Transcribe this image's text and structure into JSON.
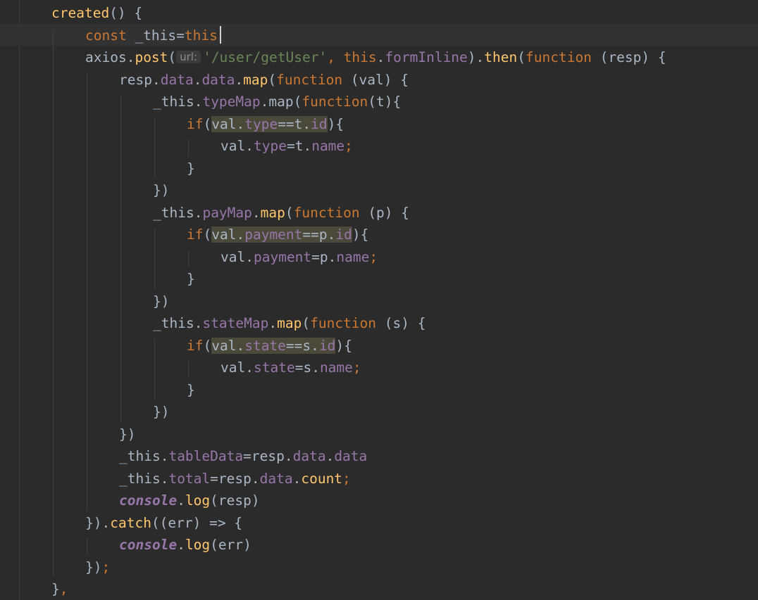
{
  "editor": {
    "theme": {
      "background": "#2b2b2b",
      "keyword": "#cc7832",
      "function": "#ffc66d",
      "property": "#9876aa",
      "string": "#6a8759",
      "text": "#a9b7c6"
    },
    "lines": [
      {
        "indent": 1,
        "tokens": [
          {
            "t": "created",
            "c": "fn"
          },
          {
            "t": "() {",
            "c": "punc"
          }
        ]
      },
      {
        "indent": 2,
        "current": true,
        "tokens": [
          {
            "t": "const ",
            "c": "kw"
          },
          {
            "t": "_this=",
            "c": "var"
          },
          {
            "t": "this",
            "c": "kw"
          }
        ]
      },
      {
        "indent": 2,
        "tokens": [
          {
            "t": "axios",
            "c": "var"
          },
          {
            "t": ".",
            "c": "punc"
          },
          {
            "t": "post",
            "c": "fn"
          },
          {
            "t": "(",
            "c": "punc"
          },
          {
            "t": "url:",
            "c": "hint"
          },
          {
            "t": "'/user/getUser'",
            "c": "str"
          },
          {
            "t": ", ",
            "c": "semi"
          },
          {
            "t": "this",
            "c": "kw"
          },
          {
            "t": ".",
            "c": "punc"
          },
          {
            "t": "formInline",
            "c": "prop"
          },
          {
            "t": ").",
            "c": "punc"
          },
          {
            "t": "then",
            "c": "fn"
          },
          {
            "t": "(",
            "c": "punc"
          },
          {
            "t": "function ",
            "c": "kw"
          },
          {
            "t": "(resp) {",
            "c": "punc"
          }
        ]
      },
      {
        "indent": 3,
        "tokens": [
          {
            "t": "resp",
            "c": "var"
          },
          {
            "t": ".",
            "c": "punc"
          },
          {
            "t": "data",
            "c": "prop"
          },
          {
            "t": ".",
            "c": "punc"
          },
          {
            "t": "data",
            "c": "prop"
          },
          {
            "t": ".",
            "c": "punc"
          },
          {
            "t": "map",
            "c": "fn"
          },
          {
            "t": "(",
            "c": "punc"
          },
          {
            "t": "function ",
            "c": "kw"
          },
          {
            "t": "(val) {",
            "c": "punc"
          }
        ]
      },
      {
        "indent": 4,
        "tokens": [
          {
            "t": "_this",
            "c": "var"
          },
          {
            "t": ".",
            "c": "punc"
          },
          {
            "t": "typeMap",
            "c": "prop"
          },
          {
            "t": ".",
            "c": "punc"
          },
          {
            "t": "map",
            "c": "var"
          },
          {
            "t": "(",
            "c": "punc"
          },
          {
            "t": "function",
            "c": "kw"
          },
          {
            "t": "(t){",
            "c": "punc"
          }
        ]
      },
      {
        "indent": 5,
        "tokens": [
          {
            "t": "if",
            "c": "kw"
          },
          {
            "t": "(",
            "c": "punc"
          },
          {
            "t": "val",
            "c": "var",
            "hl": true
          },
          {
            "t": ".",
            "c": "punc",
            "hl": true
          },
          {
            "t": "type",
            "c": "prop",
            "hl": true
          },
          {
            "t": "==",
            "c": "var",
            "hl": true
          },
          {
            "t": "t",
            "c": "var",
            "hl": true
          },
          {
            "t": ".",
            "c": "punc",
            "hl": true
          },
          {
            "t": "id",
            "c": "prop",
            "hl": true
          },
          {
            "t": "){",
            "c": "punc"
          }
        ]
      },
      {
        "indent": 6,
        "tokens": [
          {
            "t": "val",
            "c": "var"
          },
          {
            "t": ".",
            "c": "punc"
          },
          {
            "t": "type",
            "c": "prop"
          },
          {
            "t": "=",
            "c": "var"
          },
          {
            "t": "t",
            "c": "var"
          },
          {
            "t": ".",
            "c": "punc"
          },
          {
            "t": "name",
            "c": "prop"
          },
          {
            "t": ";",
            "c": "semi"
          }
        ]
      },
      {
        "indent": 5,
        "tokens": [
          {
            "t": "}",
            "c": "punc"
          }
        ]
      },
      {
        "indent": 4,
        "tokens": [
          {
            "t": "})",
            "c": "punc"
          }
        ]
      },
      {
        "indent": 4,
        "tokens": [
          {
            "t": "_this",
            "c": "var"
          },
          {
            "t": ".",
            "c": "punc"
          },
          {
            "t": "payMap",
            "c": "prop"
          },
          {
            "t": ".",
            "c": "punc"
          },
          {
            "t": "map",
            "c": "fn"
          },
          {
            "t": "(",
            "c": "punc"
          },
          {
            "t": "function ",
            "c": "kw"
          },
          {
            "t": "(p) {",
            "c": "punc"
          }
        ]
      },
      {
        "indent": 5,
        "tokens": [
          {
            "t": "if",
            "c": "kw"
          },
          {
            "t": "(",
            "c": "punc"
          },
          {
            "t": "val",
            "c": "var",
            "hl": true
          },
          {
            "t": ".",
            "c": "punc",
            "hl": true
          },
          {
            "t": "payment",
            "c": "prop",
            "hl": true
          },
          {
            "t": "==",
            "c": "var",
            "hl": true
          },
          {
            "t": "p",
            "c": "var",
            "hl": true
          },
          {
            "t": ".",
            "c": "punc",
            "hl": true
          },
          {
            "t": "id",
            "c": "prop",
            "hl": true
          },
          {
            "t": "){",
            "c": "punc"
          }
        ]
      },
      {
        "indent": 6,
        "tokens": [
          {
            "t": "val",
            "c": "var"
          },
          {
            "t": ".",
            "c": "punc"
          },
          {
            "t": "payment",
            "c": "prop"
          },
          {
            "t": "=",
            "c": "var"
          },
          {
            "t": "p",
            "c": "var"
          },
          {
            "t": ".",
            "c": "punc"
          },
          {
            "t": "name",
            "c": "prop"
          },
          {
            "t": ";",
            "c": "semi"
          }
        ]
      },
      {
        "indent": 5,
        "tokens": [
          {
            "t": "}",
            "c": "punc"
          }
        ]
      },
      {
        "indent": 4,
        "tokens": [
          {
            "t": "})",
            "c": "punc"
          }
        ]
      },
      {
        "indent": 4,
        "tokens": [
          {
            "t": "_this",
            "c": "var"
          },
          {
            "t": ".",
            "c": "punc"
          },
          {
            "t": "stateMap",
            "c": "prop"
          },
          {
            "t": ".",
            "c": "punc"
          },
          {
            "t": "map",
            "c": "fn"
          },
          {
            "t": "(",
            "c": "punc"
          },
          {
            "t": "function ",
            "c": "kw"
          },
          {
            "t": "(s) {",
            "c": "punc"
          }
        ]
      },
      {
        "indent": 5,
        "tokens": [
          {
            "t": "if",
            "c": "kw"
          },
          {
            "t": "(",
            "c": "punc"
          },
          {
            "t": "val",
            "c": "var",
            "hl": true
          },
          {
            "t": ".",
            "c": "punc",
            "hl": true
          },
          {
            "t": "state",
            "c": "prop",
            "hl": true
          },
          {
            "t": "==",
            "c": "var",
            "hl": true
          },
          {
            "t": "s",
            "c": "var",
            "hl": true
          },
          {
            "t": ".",
            "c": "punc",
            "hl": true
          },
          {
            "t": "id",
            "c": "prop",
            "hl": true
          },
          {
            "t": "){",
            "c": "punc"
          }
        ]
      },
      {
        "indent": 6,
        "tokens": [
          {
            "t": "val",
            "c": "var"
          },
          {
            "t": ".",
            "c": "punc"
          },
          {
            "t": "state",
            "c": "prop"
          },
          {
            "t": "=",
            "c": "var"
          },
          {
            "t": "s",
            "c": "var"
          },
          {
            "t": ".",
            "c": "punc"
          },
          {
            "t": "name",
            "c": "prop"
          },
          {
            "t": ";",
            "c": "semi"
          }
        ]
      },
      {
        "indent": 5,
        "tokens": [
          {
            "t": "}",
            "c": "punc"
          }
        ]
      },
      {
        "indent": 4,
        "tokens": [
          {
            "t": "})",
            "c": "punc"
          }
        ]
      },
      {
        "indent": 3,
        "tokens": [
          {
            "t": "})",
            "c": "punc"
          }
        ]
      },
      {
        "indent": 3,
        "tokens": [
          {
            "t": "_this",
            "c": "var"
          },
          {
            "t": ".",
            "c": "punc"
          },
          {
            "t": "tableData",
            "c": "prop"
          },
          {
            "t": "=",
            "c": "var"
          },
          {
            "t": "resp",
            "c": "var"
          },
          {
            "t": ".",
            "c": "punc"
          },
          {
            "t": "data",
            "c": "prop"
          },
          {
            "t": ".",
            "c": "punc"
          },
          {
            "t": "data",
            "c": "prop"
          }
        ]
      },
      {
        "indent": 3,
        "tokens": [
          {
            "t": "_this",
            "c": "var"
          },
          {
            "t": ".",
            "c": "punc"
          },
          {
            "t": "total",
            "c": "prop"
          },
          {
            "t": "=",
            "c": "var"
          },
          {
            "t": "resp",
            "c": "var"
          },
          {
            "t": ".",
            "c": "punc"
          },
          {
            "t": "data",
            "c": "prop"
          },
          {
            "t": ".",
            "c": "punc"
          },
          {
            "t": "count",
            "c": "fn"
          },
          {
            "t": ";",
            "c": "semi"
          }
        ]
      },
      {
        "indent": 3,
        "tokens": [
          {
            "t": "console",
            "c": "console"
          },
          {
            "t": ".",
            "c": "punc"
          },
          {
            "t": "log",
            "c": "fn"
          },
          {
            "t": "(resp)",
            "c": "punc"
          }
        ]
      },
      {
        "indent": 2,
        "tokens": [
          {
            "t": "}).",
            "c": "punc"
          },
          {
            "t": "catch",
            "c": "fn"
          },
          {
            "t": "((err) => {",
            "c": "punc"
          }
        ]
      },
      {
        "indent": 3,
        "tokens": [
          {
            "t": "console",
            "c": "console"
          },
          {
            "t": ".",
            "c": "punc"
          },
          {
            "t": "log",
            "c": "fn"
          },
          {
            "t": "(err)",
            "c": "punc"
          }
        ]
      },
      {
        "indent": 2,
        "tokens": [
          {
            "t": "})",
            "c": "punc"
          },
          {
            "t": ";",
            "c": "semi"
          }
        ]
      },
      {
        "indent": 1,
        "tokens": [
          {
            "t": "}",
            "c": "punc"
          },
          {
            "t": ",",
            "c": "semi"
          }
        ]
      }
    ]
  }
}
